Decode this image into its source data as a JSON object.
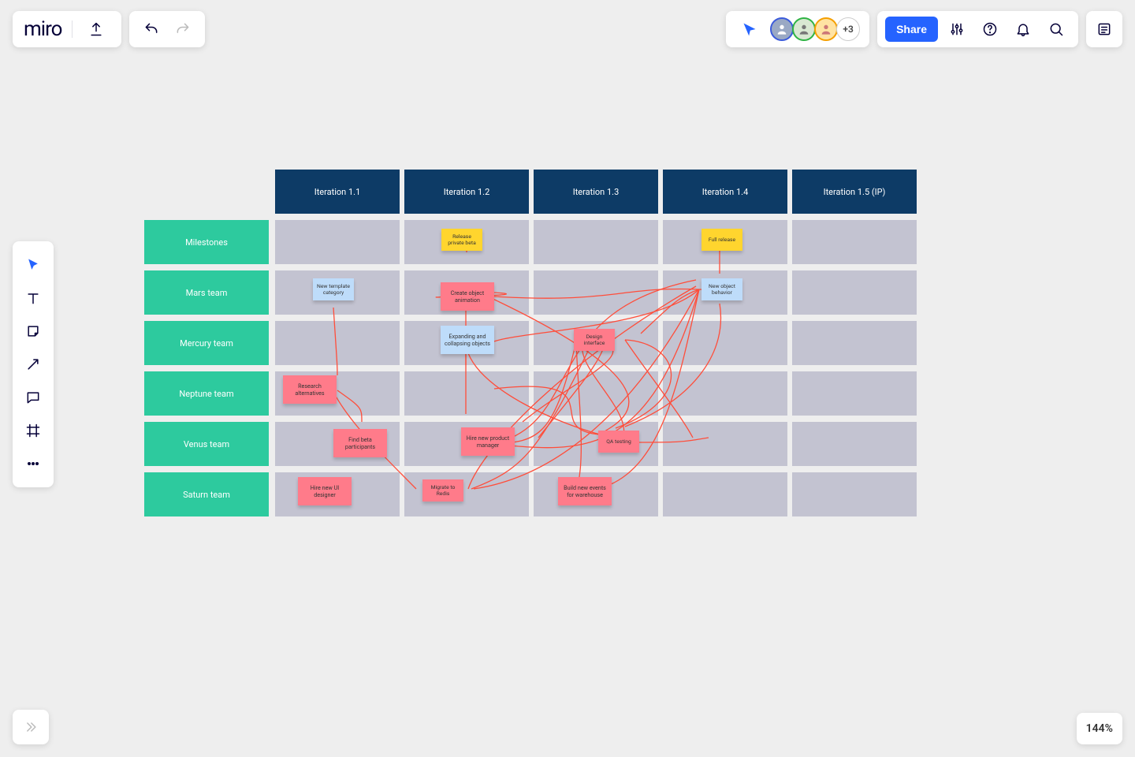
{
  "brand": "miro",
  "presence": {
    "overflow_label": "+3"
  },
  "share_label": "Share",
  "zoom_label": "144%",
  "columns": [
    "Iteration 1.1",
    "Iteration 1.2",
    "Iteration 1.3",
    "Iteration 1.4",
    "Iteration 1.5 (IP)"
  ],
  "rows": [
    "Milestones",
    "Mars team",
    "Mercury team",
    "Neptune team",
    "Venus team",
    "Saturn team"
  ],
  "stickies": {
    "release_private_beta": "Release private beta",
    "full_release": "Full release",
    "new_template_category": "New template category",
    "create_object_animation": "Create object animation",
    "new_object_behavior": "New object behavior",
    "expanding_collapsing": "Expanding and collapsing objects",
    "design_interface": "Design interface",
    "research_alternatives": "Research alternatives",
    "find_beta_participants": "Find beta participants",
    "hire_new_pm": "Hire new product manager",
    "qa_testing": "QA testing",
    "hire_new_ui_designer": "Hire new UI designer",
    "migrate_to_redis": "Migrate to Redis",
    "build_new_events": "Build new events for warehouse"
  }
}
